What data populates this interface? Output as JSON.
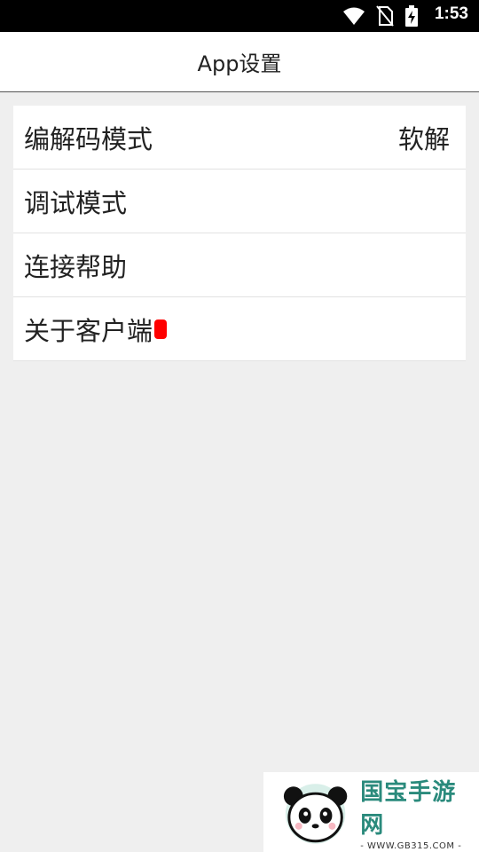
{
  "status_bar": {
    "time": "1:53",
    "icons": [
      "wifi-icon",
      "no-sim-icon",
      "battery-charging-icon"
    ]
  },
  "app_bar": {
    "title": "App设置"
  },
  "settings": {
    "items": [
      {
        "label": "编解码模式",
        "value": "软解"
      },
      {
        "label": "调试模式"
      },
      {
        "label": "连接帮助"
      },
      {
        "label": "关于客户端"
      }
    ]
  },
  "watermark": {
    "title": "国宝手游网",
    "subtitle": "- WWW.GB315.COM -",
    "logo": "panda-logo-icon"
  },
  "colors": {
    "status_bar_bg": "#000000",
    "background": "#efefef",
    "card_bg": "#ffffff",
    "badge_red": "#ff0000",
    "watermark_green": "#2a8a7c"
  }
}
